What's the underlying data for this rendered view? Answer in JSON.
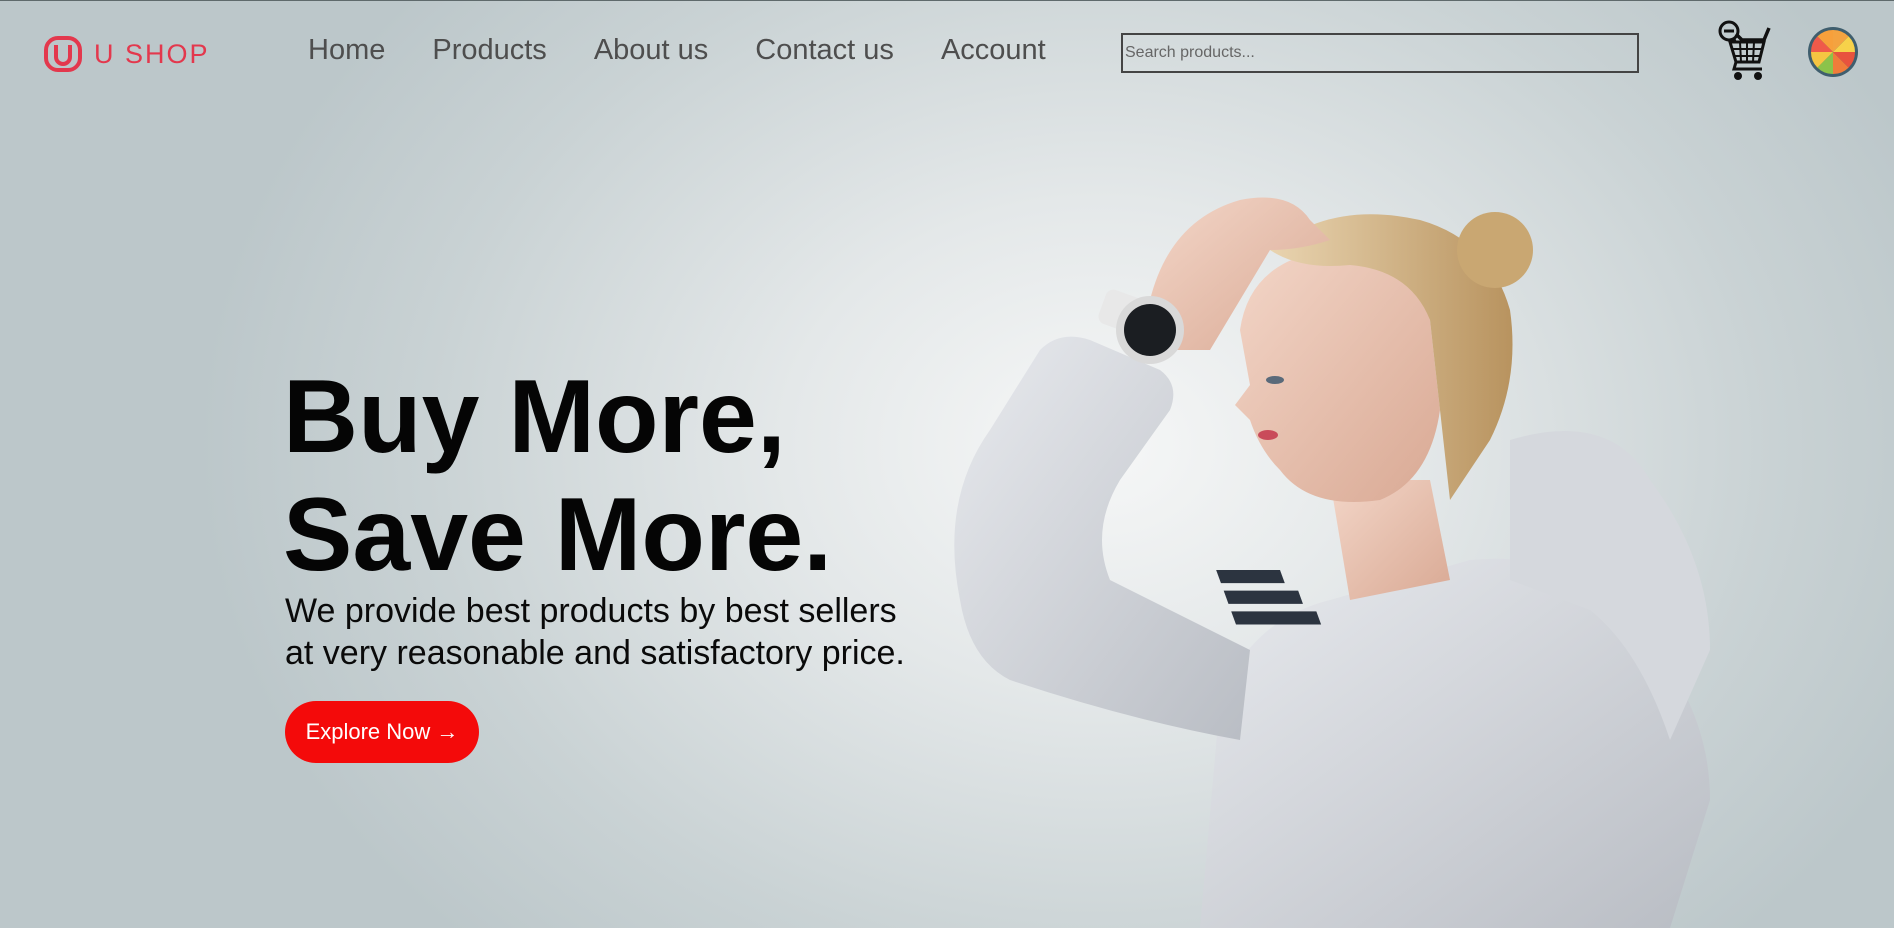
{
  "brand": {
    "name": "U SHOP",
    "color": "#e3384d"
  },
  "nav": {
    "items": [
      {
        "label": "Home"
      },
      {
        "label": "Products"
      },
      {
        "label": "About us"
      },
      {
        "label": "Contact us"
      },
      {
        "label": "Account"
      }
    ]
  },
  "search": {
    "placeholder": "Search products...",
    "value": ""
  },
  "header_icons": {
    "cart": "shopping-cart-icon",
    "avatar": "color-wheel-avatar"
  },
  "hero": {
    "title_line1": "Buy More,",
    "title_line2": "Save More.",
    "subtitle_line1": "We provide best products by best sellers",
    "subtitle_line2": "at very reasonable and satisfactory price.",
    "cta_label": "Explore Now →",
    "cta_color": "#f40a0a",
    "image_brand_text": "adidas"
  }
}
